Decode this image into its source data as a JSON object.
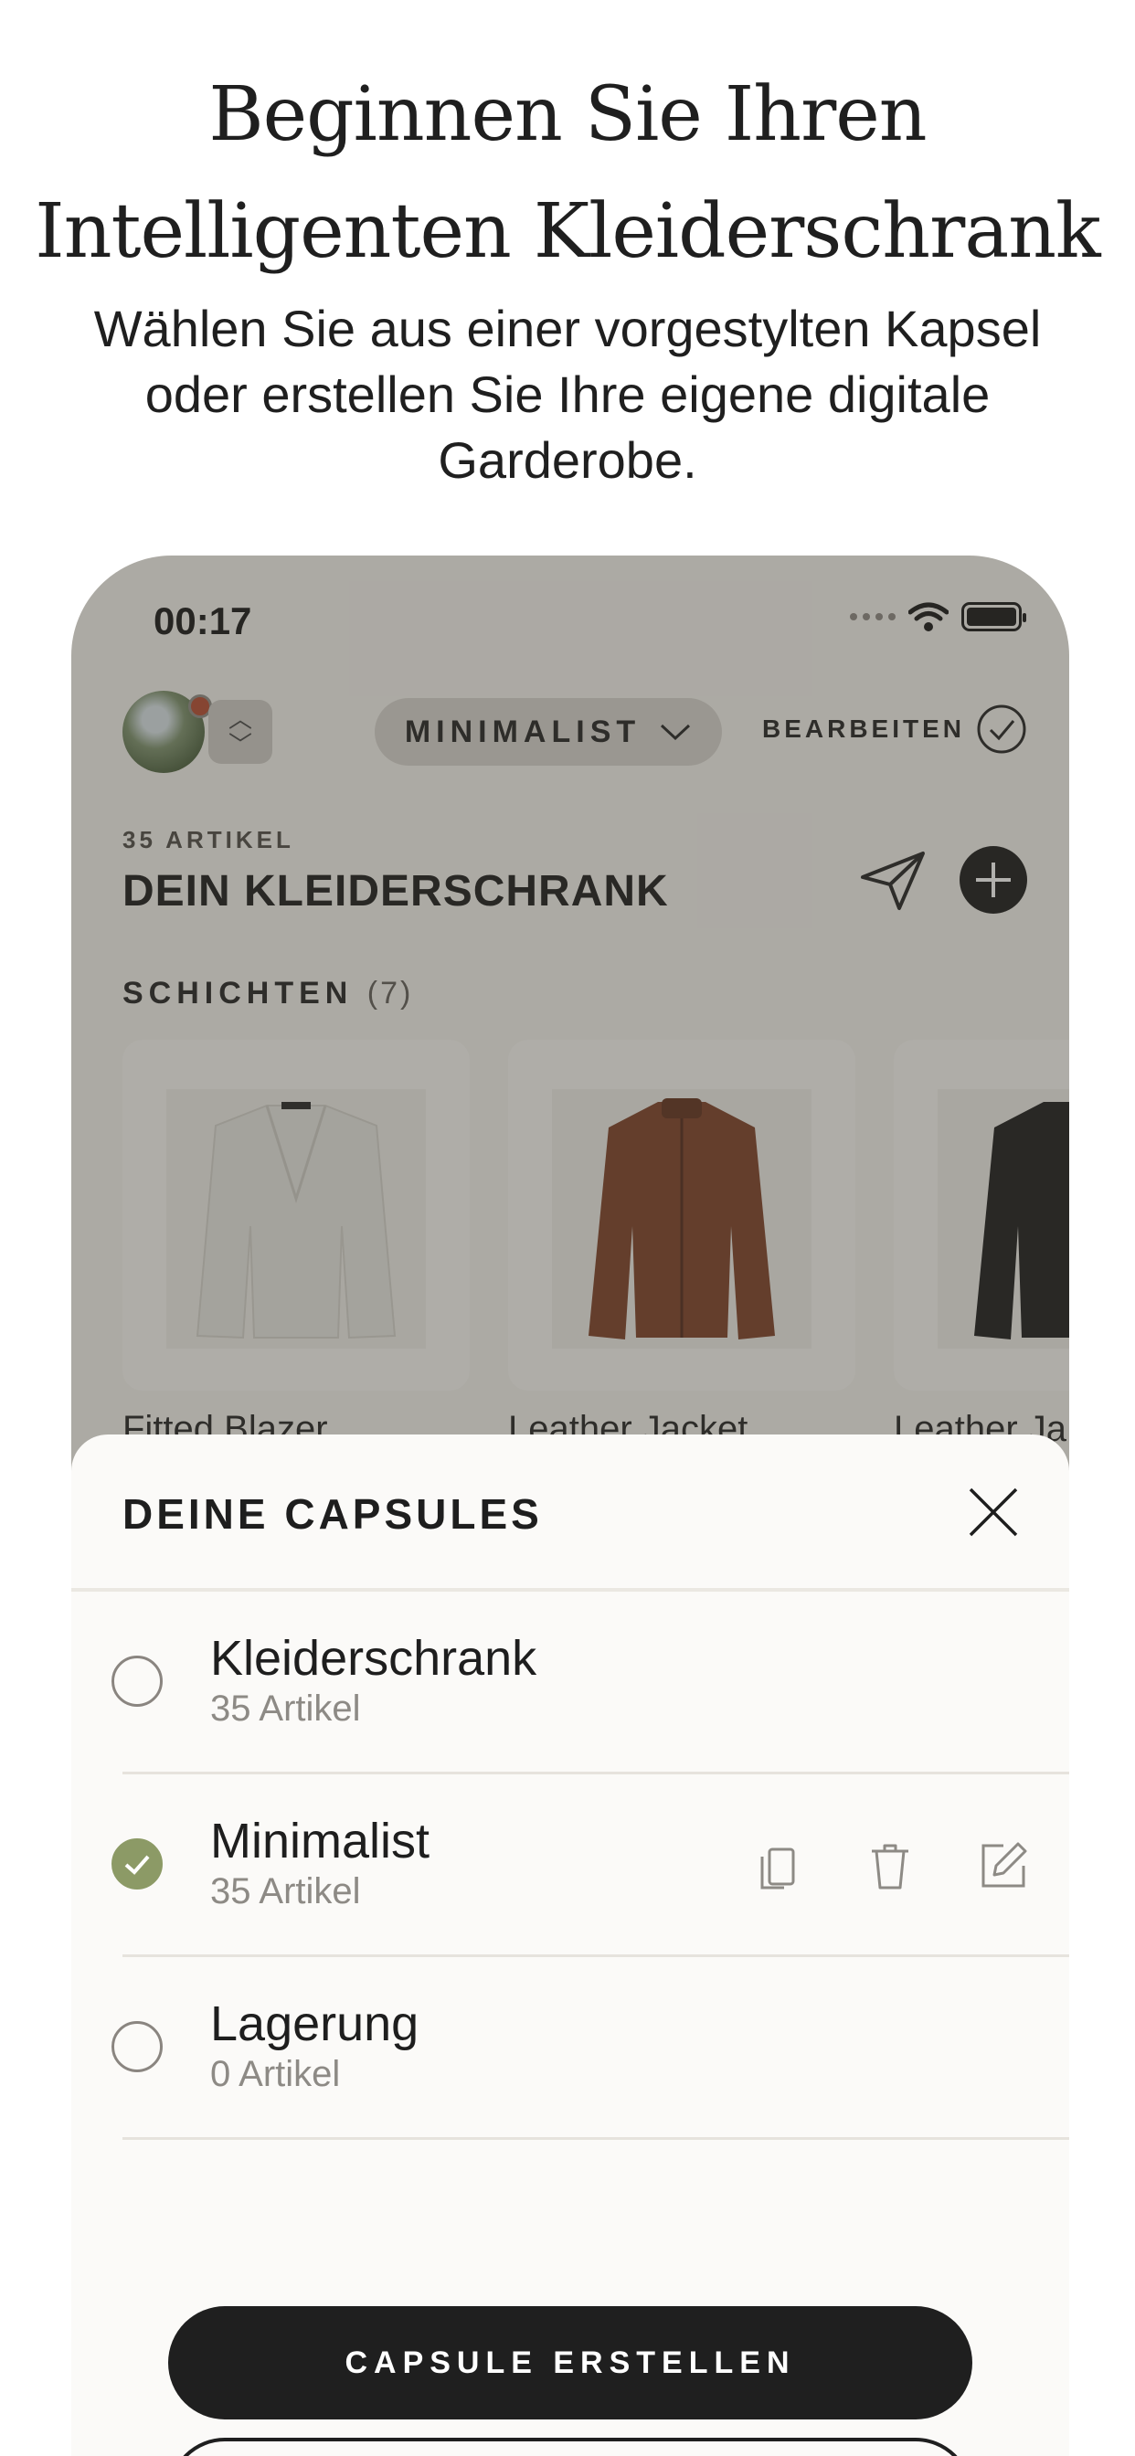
{
  "headline": {
    "line1": "Beginnen Sie Ihren",
    "line2": "Intelligenten Kleiderschrank",
    "subtitle": "Wählen Sie aus einer vorgestylten Kapsel oder erstellen Sie Ihre eigene digitale Garderobe."
  },
  "status_bar": {
    "time": "00:17"
  },
  "app_header": {
    "capsule_selector": "MINIMALIST",
    "edit_label": "BEARBEITEN"
  },
  "wardrobe": {
    "item_count": "35 ARTIKEL",
    "title": "DEIN KLEIDERSCHRANK",
    "section": {
      "title": "SCHICHTEN",
      "count": "(7)"
    },
    "items": [
      {
        "name": "Fitted Blazer",
        "color": "#ecebe6"
      },
      {
        "name": "Leather Jacket",
        "color": "#7a3b22"
      },
      {
        "name": "Leather Ja",
        "color": "#151515"
      }
    ]
  },
  "sheet": {
    "title": "DEINE CAPSULES",
    "capsules": [
      {
        "name": "Kleiderschrank",
        "count": "35 Artikel",
        "selected": false
      },
      {
        "name": "Minimalist",
        "count": "35 Artikel",
        "selected": true
      },
      {
        "name": "Lagerung",
        "count": "0 Artikel",
        "selected": false
      }
    ],
    "create_button": "CAPSULE ERSTELLEN"
  },
  "colors": {
    "accent_green": "#8c9a66",
    "dark": "#1f1f1f",
    "overlay": "rgba(70,66,60,0.42)"
  }
}
